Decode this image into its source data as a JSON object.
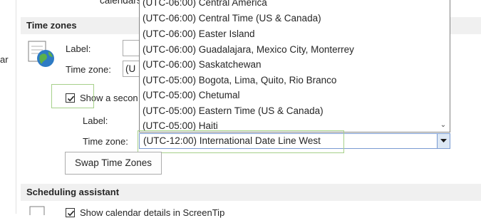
{
  "nav": {
    "cut_text": "ar"
  },
  "top_cut_text": "calendars is fo",
  "time_zones": {
    "header": "Time zones",
    "label_caption": "Label:",
    "timezone_caption": "Time zone:",
    "timezone_partial": "(U",
    "show_second_label": "Show a secon",
    "second_label_caption": "Label:",
    "second_timezone_caption": "Time zone:",
    "selected_value": "(UTC-12:00) International Date Line West",
    "swap_button": "Swap Time Zones"
  },
  "dropdown_items": [
    "(UTC-06:00) Central America",
    "(UTC-06:00) Central Time (US & Canada)",
    "(UTC-06:00) Easter Island",
    "(UTC-06:00) Guadalajara, Mexico City, Monterrey",
    "(UTC-06:00) Saskatchewan",
    "(UTC-05:00) Bogota, Lima, Quito, Rio Branco",
    "(UTC-05:00) Chetumal",
    "(UTC-05:00) Eastern Time (US & Canada)",
    "(UTC-05:00) Haiti"
  ],
  "scheduling": {
    "header": "Scheduling assistant",
    "show_details_label": "Show calendar details in ScreenTip"
  },
  "colors": {
    "highlight": "#a6d08a",
    "combo_border": "#7a9bd2",
    "header_bg": "#f0f0f0"
  }
}
